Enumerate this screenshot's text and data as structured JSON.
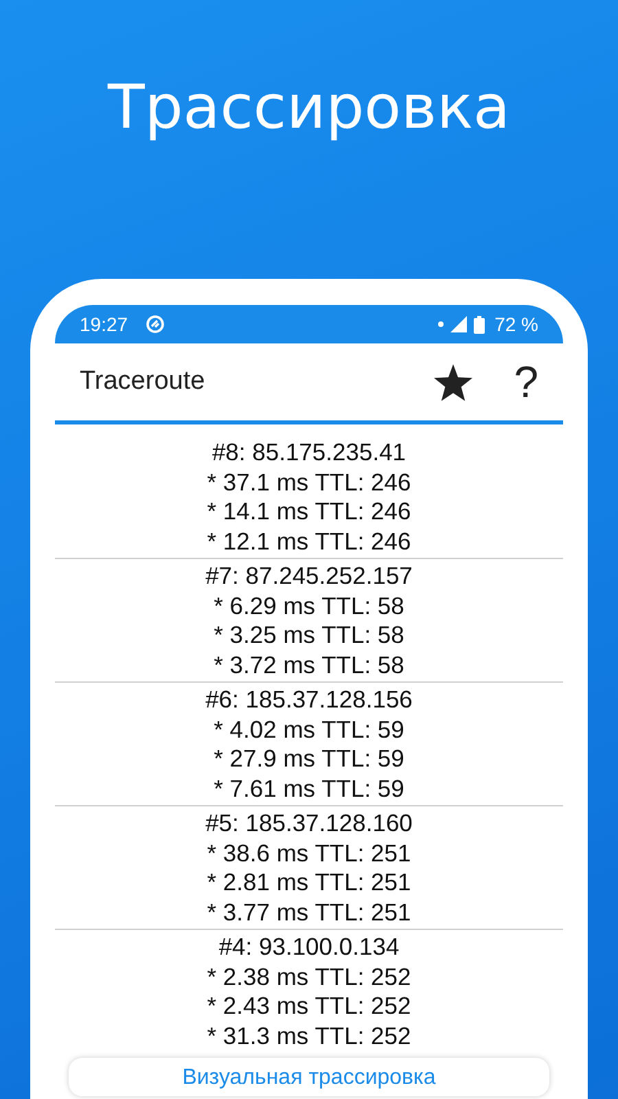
{
  "headline": "Трассировка",
  "status_bar": {
    "time": "19:27",
    "battery": "72 %"
  },
  "app_bar": {
    "title": "Traceroute",
    "help": "?"
  },
  "hops": [
    {
      "header": "#8: 85.175.235.41",
      "pings": [
        "* 37.1 ms TTL: 246",
        "* 14.1 ms TTL: 246",
        "* 12.1 ms TTL: 246"
      ]
    },
    {
      "header": "#7: 87.245.252.157",
      "pings": [
        "* 6.29 ms TTL: 58",
        "* 3.25 ms TTL: 58",
        "* 3.72 ms TTL: 58"
      ]
    },
    {
      "header": "#6: 185.37.128.156",
      "pings": [
        "* 4.02 ms TTL: 59",
        "* 27.9 ms TTL: 59",
        "* 7.61 ms TTL: 59"
      ]
    },
    {
      "header": "#5: 185.37.128.160",
      "pings": [
        "* 38.6 ms TTL: 251",
        "* 2.81 ms TTL: 251",
        "* 3.77 ms TTL: 251"
      ]
    },
    {
      "header": "#4: 93.100.0.134",
      "pings": [
        "* 2.38 ms TTL: 252",
        "* 2.43 ms TTL: 252",
        "* 31.3 ms TTL: 252"
      ]
    }
  ],
  "visual_button": "Визуальная трассировка"
}
